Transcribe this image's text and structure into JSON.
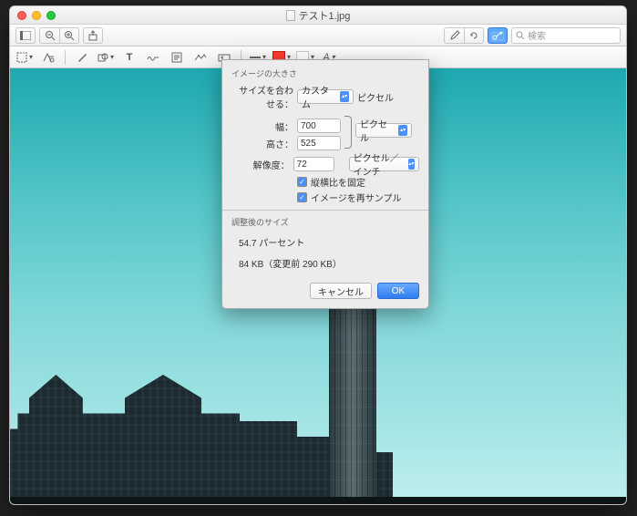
{
  "window": {
    "title": "テスト1.jpg"
  },
  "toolbar": {
    "search_placeholder": "検索"
  },
  "dialog": {
    "section_label": "イメージの大きさ",
    "fit_label": "サイズを合わせる：",
    "fit_value": "カスタム",
    "fit_unit": "ピクセル",
    "width_label": "幅：",
    "width_value": "700",
    "height_label": "高さ：",
    "height_value": "525",
    "dim_unit": "ピクセル",
    "resolution_label": "解像度：",
    "resolution_value": "72",
    "resolution_unit": "ピクセル／インチ",
    "lock_ratio_label": "縦横比を固定",
    "resample_label": "イメージを再サンプル",
    "result_section_label": "調整後のサイズ",
    "result_percent": "54.7 パーセント",
    "result_size": "84 KB（変更前 290 KB）",
    "cancel": "キャンセル",
    "ok": "OK"
  }
}
